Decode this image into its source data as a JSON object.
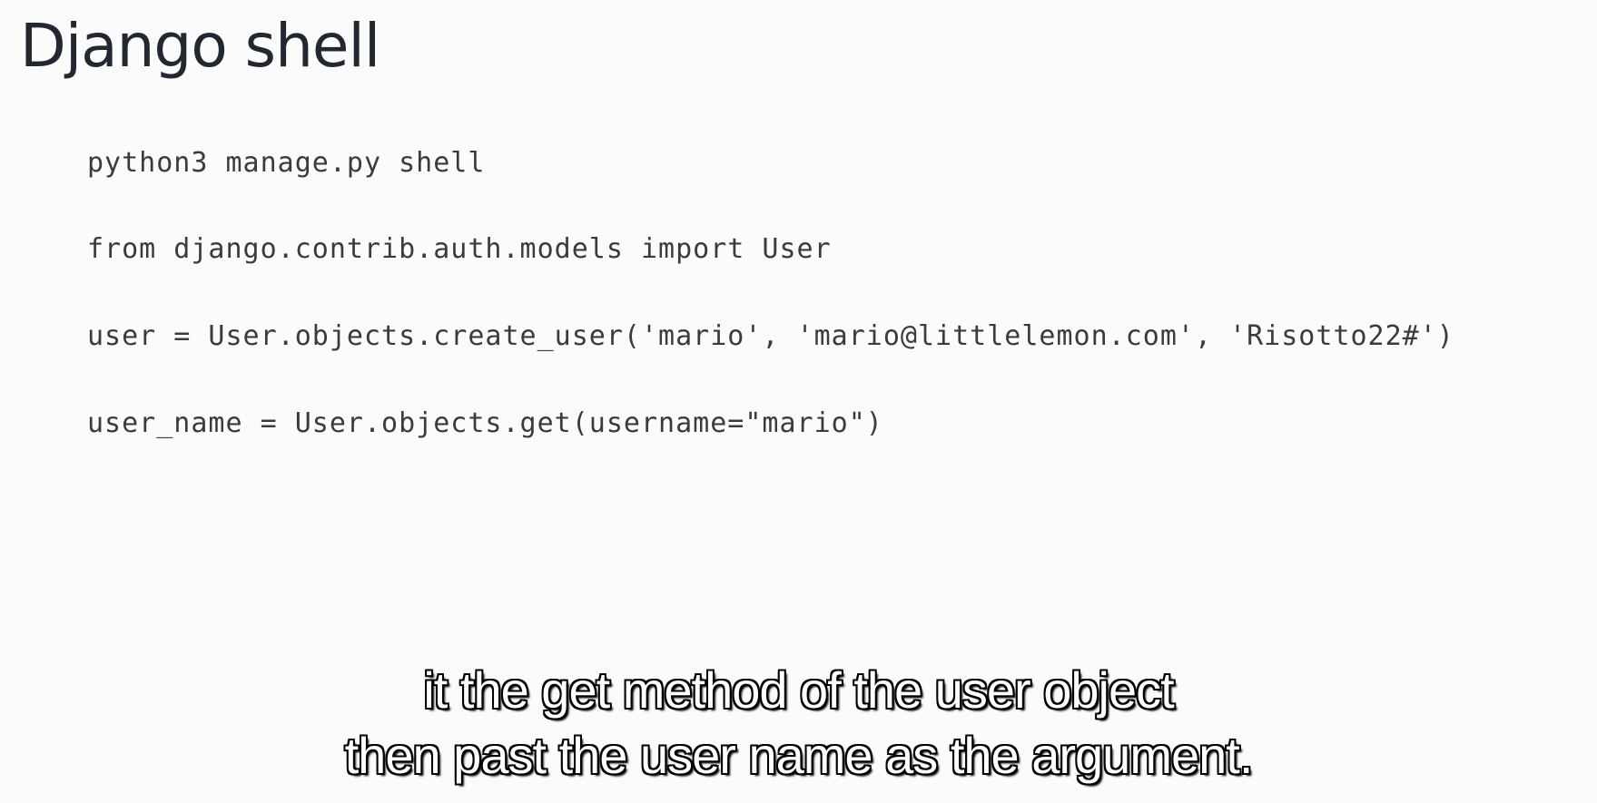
{
  "slide": {
    "title": "Django shell",
    "code_lines": [
      "python3 manage.py shell",
      "from django.contrib.auth.models import User",
      "user = User.objects.create_user('mario', 'mario@littlelemon.com', 'Risotto22#')",
      "user_name = User.objects.get(username=\"mario\")"
    ]
  },
  "caption": {
    "lines": [
      "it the get method of the user object",
      "then past the user name as the argument."
    ]
  },
  "colors": {
    "background": "#fbfbfb",
    "title": "#222831",
    "code": "#3b3b3b",
    "caption_fill": "#ffffff",
    "caption_outline": "#000000"
  }
}
